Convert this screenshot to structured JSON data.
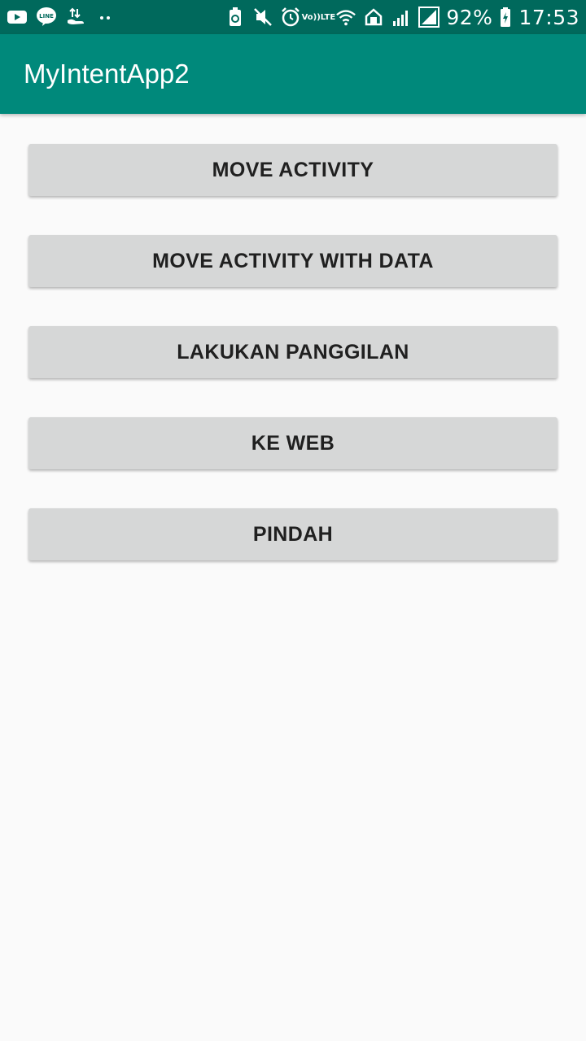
{
  "status_bar": {
    "left_icons": [
      "youtube-icon",
      "line-icon",
      "transfer-icon",
      "dots-icon"
    ],
    "right_icons": [
      "recycle-icon",
      "mute-icon",
      "alarm-icon",
      "volte-icon",
      "wifi-icon",
      "sync-icon",
      "signal-icon",
      "signal-icon-2",
      "battery-charging-icon"
    ],
    "volte_label_top": "Vo))",
    "volte_label_bottom": "LTE",
    "battery": "92%",
    "time": "17:53"
  },
  "app_bar": {
    "title": "MyIntentApp2"
  },
  "buttons": [
    {
      "label": "MOVE ACTIVITY"
    },
    {
      "label": "MOVE ACTIVITY WITH DATA"
    },
    {
      "label": "LAKUKAN PANGGILAN"
    },
    {
      "label": "KE WEB"
    },
    {
      "label": "PINDAH"
    }
  ],
  "colors": {
    "status_bar": "#00695c",
    "app_bar": "#00897b",
    "background": "#fafafa",
    "button": "#d6d7d7",
    "button_text": "#202020"
  }
}
